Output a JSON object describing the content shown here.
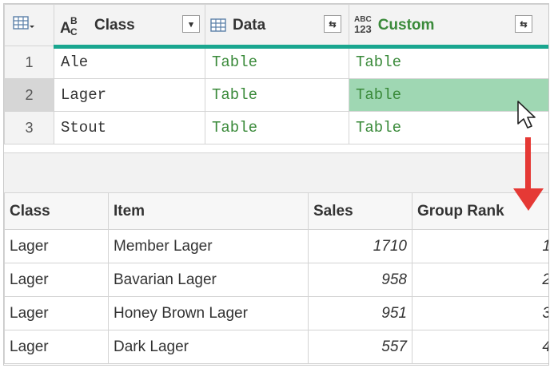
{
  "query_grid": {
    "columns": [
      {
        "name": "Class",
        "type_icon": "abc-text-icon"
      },
      {
        "name": "Data",
        "type_icon": "table-icon"
      },
      {
        "name": "Custom",
        "type_icon": "abc-123-icon",
        "type_top": "ABC",
        "type_bottom": "123"
      }
    ],
    "rows": [
      {
        "num": "1",
        "class": "Ale",
        "data": "Table",
        "custom": "Table"
      },
      {
        "num": "2",
        "class": "Lager",
        "data": "Table",
        "custom": "Table"
      },
      {
        "num": "3",
        "class": "Stout",
        "data": "Table",
        "custom": "Table"
      }
    ],
    "selected_row": 2,
    "highlight_color": "#9fd7b3",
    "accent_color": "#19a68f"
  },
  "preview_table": {
    "headers": [
      "Class",
      "Item",
      "Sales",
      "Group Rank"
    ],
    "rows": [
      [
        "Lager",
        "Member Lager",
        "1710",
        "1"
      ],
      [
        "Lager",
        "Bavarian Lager",
        "958",
        "2"
      ],
      [
        "Lager",
        "Honey Brown Lager",
        "951",
        "3"
      ],
      [
        "Lager",
        "Dark Lager",
        "557",
        "4"
      ]
    ]
  },
  "annotation": {
    "arrow_color": "#e53935"
  }
}
